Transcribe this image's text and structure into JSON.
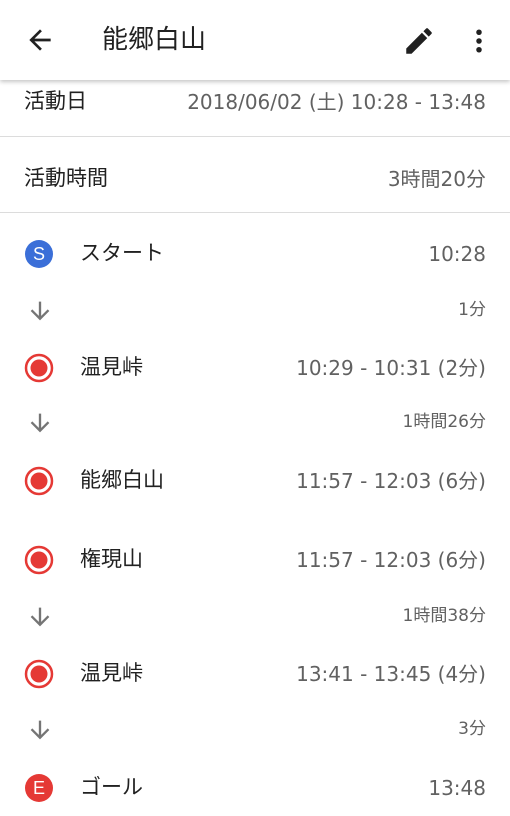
{
  "header": {
    "title": "能郷白山"
  },
  "activity_date": {
    "label": "活動日",
    "value": "2018/06/02 (土) 10:28 - 13:48"
  },
  "activity_time": {
    "label": "活動時間",
    "value": "3時間20分"
  },
  "markers": {
    "start_letter": "S",
    "end_letter": "E"
  },
  "colors": {
    "start": "#3b6fd8",
    "waypoint": "#e53935",
    "end": "#e53935",
    "arrow": "#757575"
  },
  "timeline": [
    {
      "type": "start",
      "name": "スタート",
      "time": "10:28"
    },
    {
      "type": "gap",
      "duration": "1分"
    },
    {
      "type": "waypoint",
      "name": "温見峠",
      "time": "10:29 - 10:31 (2分)"
    },
    {
      "type": "gap",
      "duration": "1時間26分"
    },
    {
      "type": "waypoint",
      "name": "能郷白山",
      "time": "11:57 - 12:03 (6分)"
    },
    {
      "type": "waypoint",
      "name": "権現山",
      "time": "11:57 - 12:03 (6分)"
    },
    {
      "type": "gap",
      "duration": "1時間38分"
    },
    {
      "type": "waypoint",
      "name": "温見峠",
      "time": "13:41 - 13:45 (4分)"
    },
    {
      "type": "gap",
      "duration": "3分"
    },
    {
      "type": "end",
      "name": "ゴール",
      "time": "13:48"
    }
  ]
}
